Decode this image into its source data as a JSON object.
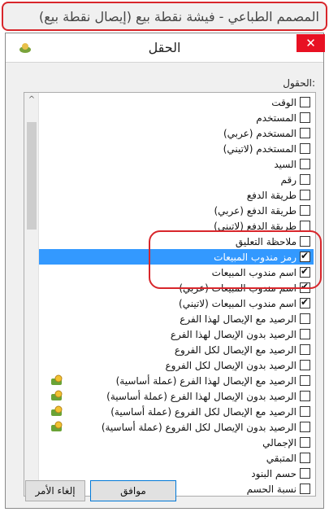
{
  "window_title": "المصمم الطباعي - فيشة نقطة بيع (إيصال نقطة بيع)",
  "dialog": {
    "title": "الحقل",
    "close_symbol": "✕",
    "fields_label": "الحقول:"
  },
  "fields": [
    {
      "label": "الوقت",
      "checked": false,
      "selected": false,
      "icon": ""
    },
    {
      "label": "المستخدم",
      "checked": false,
      "selected": false,
      "icon": ""
    },
    {
      "label": "المستخدم (عربي)",
      "checked": false,
      "selected": false,
      "icon": ""
    },
    {
      "label": "المستخدم (لاتيني)",
      "checked": false,
      "selected": false,
      "icon": ""
    },
    {
      "label": "السيد",
      "checked": false,
      "selected": false,
      "icon": ""
    },
    {
      "label": "رقم",
      "checked": false,
      "selected": false,
      "icon": ""
    },
    {
      "label": "طريقة الدفع",
      "checked": false,
      "selected": false,
      "icon": ""
    },
    {
      "label": "طريقة الدفع (عربي)",
      "checked": false,
      "selected": false,
      "icon": ""
    },
    {
      "label": "طريقة الدفع (لاتيني)",
      "checked": false,
      "selected": false,
      "icon": ""
    },
    {
      "label": "ملاحظة التعليق",
      "checked": false,
      "selected": false,
      "icon": ""
    },
    {
      "label": "رمز مندوب المبيعات",
      "checked": true,
      "selected": true,
      "icon": ""
    },
    {
      "label": "اسم مندوب المبيعات",
      "checked": true,
      "selected": false,
      "icon": ""
    },
    {
      "label": "اسم مندوب المبيعات (عربي)",
      "checked": true,
      "selected": false,
      "icon": ""
    },
    {
      "label": "اسم مندوب المبيعات (لاتيني)",
      "checked": true,
      "selected": false,
      "icon": ""
    },
    {
      "label": "الرصيد مع الإيصال لهذا الفرع",
      "checked": false,
      "selected": false,
      "icon": ""
    },
    {
      "label": "الرصيد بدون الإيصال لهذا الفرع",
      "checked": false,
      "selected": false,
      "icon": ""
    },
    {
      "label": "الرصيد مع الإيصال لكل الفروع",
      "checked": false,
      "selected": false,
      "icon": ""
    },
    {
      "label": "الرصيد بدون الإيصال لكل الفروع",
      "checked": false,
      "selected": false,
      "icon": ""
    },
    {
      "label": "الرصيد مع الإيصال لهذا الفرع (عملة أساسية)",
      "checked": false,
      "selected": false,
      "icon": "currency-icon"
    },
    {
      "label": "الرصيد بدون الإيصال لهذا الفرع (عملة أساسية)",
      "checked": false,
      "selected": false,
      "icon": "currency-icon"
    },
    {
      "label": "الرصيد مع الإيصال لكل الفروع (عملة أساسية)",
      "checked": false,
      "selected": false,
      "icon": "currency-icon"
    },
    {
      "label": "الرصيد بدون الإيصال لكل الفروع (عملة أساسية)",
      "checked": false,
      "selected": false,
      "icon": "currency-icon"
    },
    {
      "label": "الإجمالي",
      "checked": false,
      "selected": false,
      "icon": ""
    },
    {
      "label": "المتبقي",
      "checked": false,
      "selected": false,
      "icon": ""
    },
    {
      "label": "حسم البنود",
      "checked": false,
      "selected": false,
      "icon": ""
    },
    {
      "label": "نسبة الحسم",
      "checked": false,
      "selected": false,
      "icon": ""
    }
  ],
  "scroll": {
    "up_symbol": "^",
    "down_symbol": "v"
  },
  "buttons": {
    "ok": "موافق",
    "cancel": "إلغاء الأمر"
  },
  "colors": {
    "selection": "#3399ff",
    "annotation": "#d8262b",
    "close": "#e81123"
  }
}
